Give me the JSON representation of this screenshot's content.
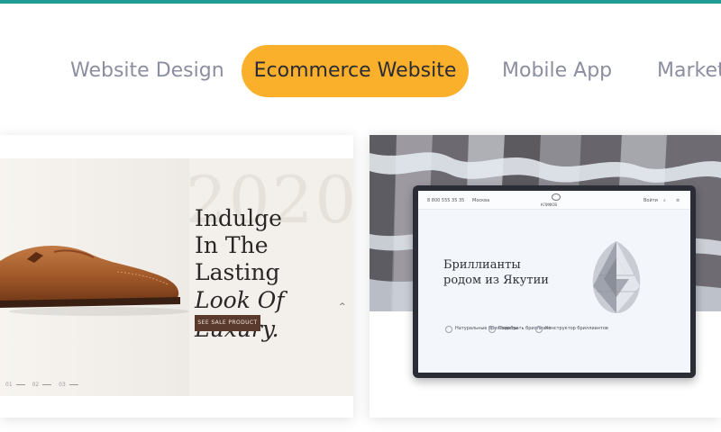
{
  "tabs": [
    {
      "label": "Website Design",
      "active": false
    },
    {
      "label": "Ecommerce Website",
      "active": true
    },
    {
      "label": "Mobile App",
      "active": false
    },
    {
      "label": "Market",
      "active": false
    }
  ],
  "colors": {
    "top_bar": "#1f9c93",
    "active_tab": "#fbb02c",
    "tab_text": "#8b8ea0"
  },
  "card1": {
    "year": "2020",
    "headline": [
      "Indulge",
      "In The Lasting",
      "Look Of Luxury."
    ],
    "button": "SEE SALE PRODUCT",
    "slider_dots": [
      "01",
      "02",
      "03"
    ]
  },
  "card2": {
    "nav_left": "8 800 555 35 35",
    "nav_city": "Москва",
    "nav_brand": "КЛИФОВ",
    "nav_right": "Войти",
    "heading": [
      "Бриллианты",
      "родом из Якутии"
    ],
    "features": [
      "Натуральные бриллианты",
      "Подобрать бриллиант",
      "Конструктор бриллиантов"
    ]
  }
}
